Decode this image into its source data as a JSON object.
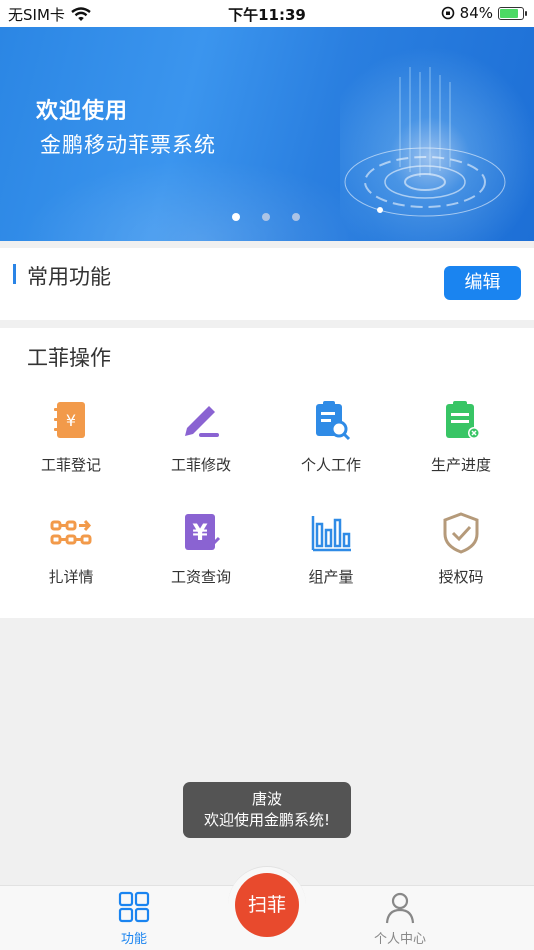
{
  "status_bar": {
    "carrier": "无SIM卡",
    "time": "下午11:39",
    "battery": "84%",
    "battery_level": 0.84
  },
  "banner": {
    "line1": "欢迎使用",
    "line2": "金鹏移动菲票系统",
    "page_count": 3,
    "active_page": 0
  },
  "common": {
    "title": "常用功能",
    "edit_label": "编辑"
  },
  "operations": {
    "title": "工菲操作",
    "items": [
      {
        "label": "工菲登记",
        "icon": "notebook-yen-icon",
        "color": "#f29a4a"
      },
      {
        "label": "工菲修改",
        "icon": "pencil-edit-icon",
        "color": "#8a63d2"
      },
      {
        "label": "个人工作",
        "icon": "clipboard-search-icon",
        "color": "#2f8be6"
      },
      {
        "label": "生产进度",
        "icon": "clipboard-progress-icon",
        "color": "#38c565"
      },
      {
        "label": "扎详情",
        "icon": "chain-flow-icon",
        "color": "#f29a4a"
      },
      {
        "label": "工资查询",
        "icon": "salary-yen-icon",
        "color": "#8a63d2"
      },
      {
        "label": "组产量",
        "icon": "bar-chart-icon",
        "color": "#2f8be6"
      },
      {
        "label": "授权码",
        "icon": "shield-check-icon",
        "color": "#b59a7a"
      }
    ]
  },
  "toast": {
    "line1": "唐波",
    "line2": "欢迎使用金鹏系统!"
  },
  "tabbar": {
    "tabs": [
      {
        "label": "功能",
        "icon": "grid-icon",
        "active": true
      },
      {
        "label": "个人中心",
        "icon": "person-icon",
        "active": false
      }
    ],
    "scan_label": "扫菲"
  },
  "colors": {
    "accent": "#1a84f0",
    "scan": "#e84a2d"
  }
}
